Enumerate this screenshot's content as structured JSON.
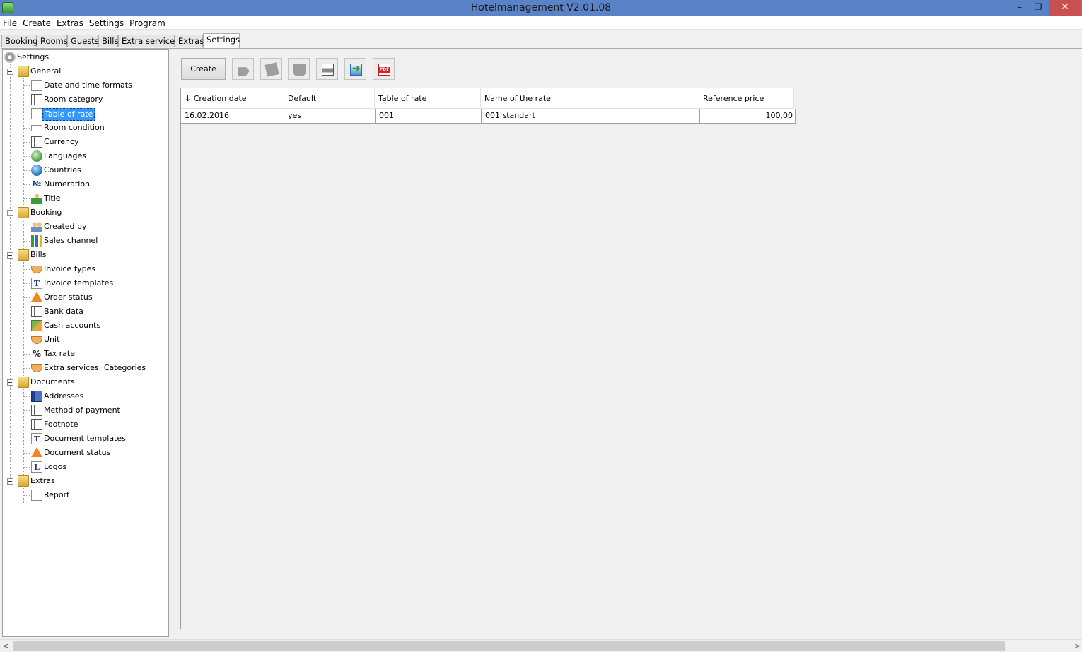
{
  "window": {
    "title": "Hotelmanagement V2.01.08",
    "minimize": "–",
    "maximize": "❐",
    "close": "✕"
  },
  "menu": [
    "File",
    "Create",
    "Extras",
    "Settings",
    "Program"
  ],
  "tabs": [
    "Booking",
    "Rooms",
    "Guests",
    "Bills",
    "Extra services",
    "Extras",
    "Settings"
  ],
  "active_tab": "Settings",
  "tree": {
    "root": "Settings",
    "groups": [
      {
        "label": "General",
        "items": [
          "Date and time formats",
          "Room category",
          "Table of rate",
          "Room condition",
          "Currency",
          "Languages",
          "Countries",
          "Numeration",
          "Title"
        ]
      },
      {
        "label": "Booking",
        "items": [
          "Created by",
          "Sales channel"
        ]
      },
      {
        "label": "Bills",
        "items": [
          "Invoice types",
          "Invoice templates",
          "Order status",
          "Bank data",
          "Cash accounts",
          "Unit",
          "Tax rate",
          "Extra services: Categories"
        ]
      },
      {
        "label": "Documents",
        "items": [
          "Addresses",
          "Method of payment",
          "Footnote",
          "Document templates",
          "Document status",
          "Logos"
        ]
      },
      {
        "label": "Extras",
        "items": [
          "Report"
        ]
      }
    ],
    "selected": "Table of rate"
  },
  "toolbar": {
    "create_label": "Create"
  },
  "table": {
    "sort_indicator": "↓",
    "columns": [
      "Creation date",
      "Default",
      "Table of rate",
      "Name of the rate",
      "Reference price"
    ],
    "rows": [
      [
        "16.02.2016",
        "yes",
        "001",
        "001 standart",
        "100,00"
      ]
    ]
  },
  "scrollbar": {
    "left_arrow": "<",
    "right_arrow": ">"
  }
}
